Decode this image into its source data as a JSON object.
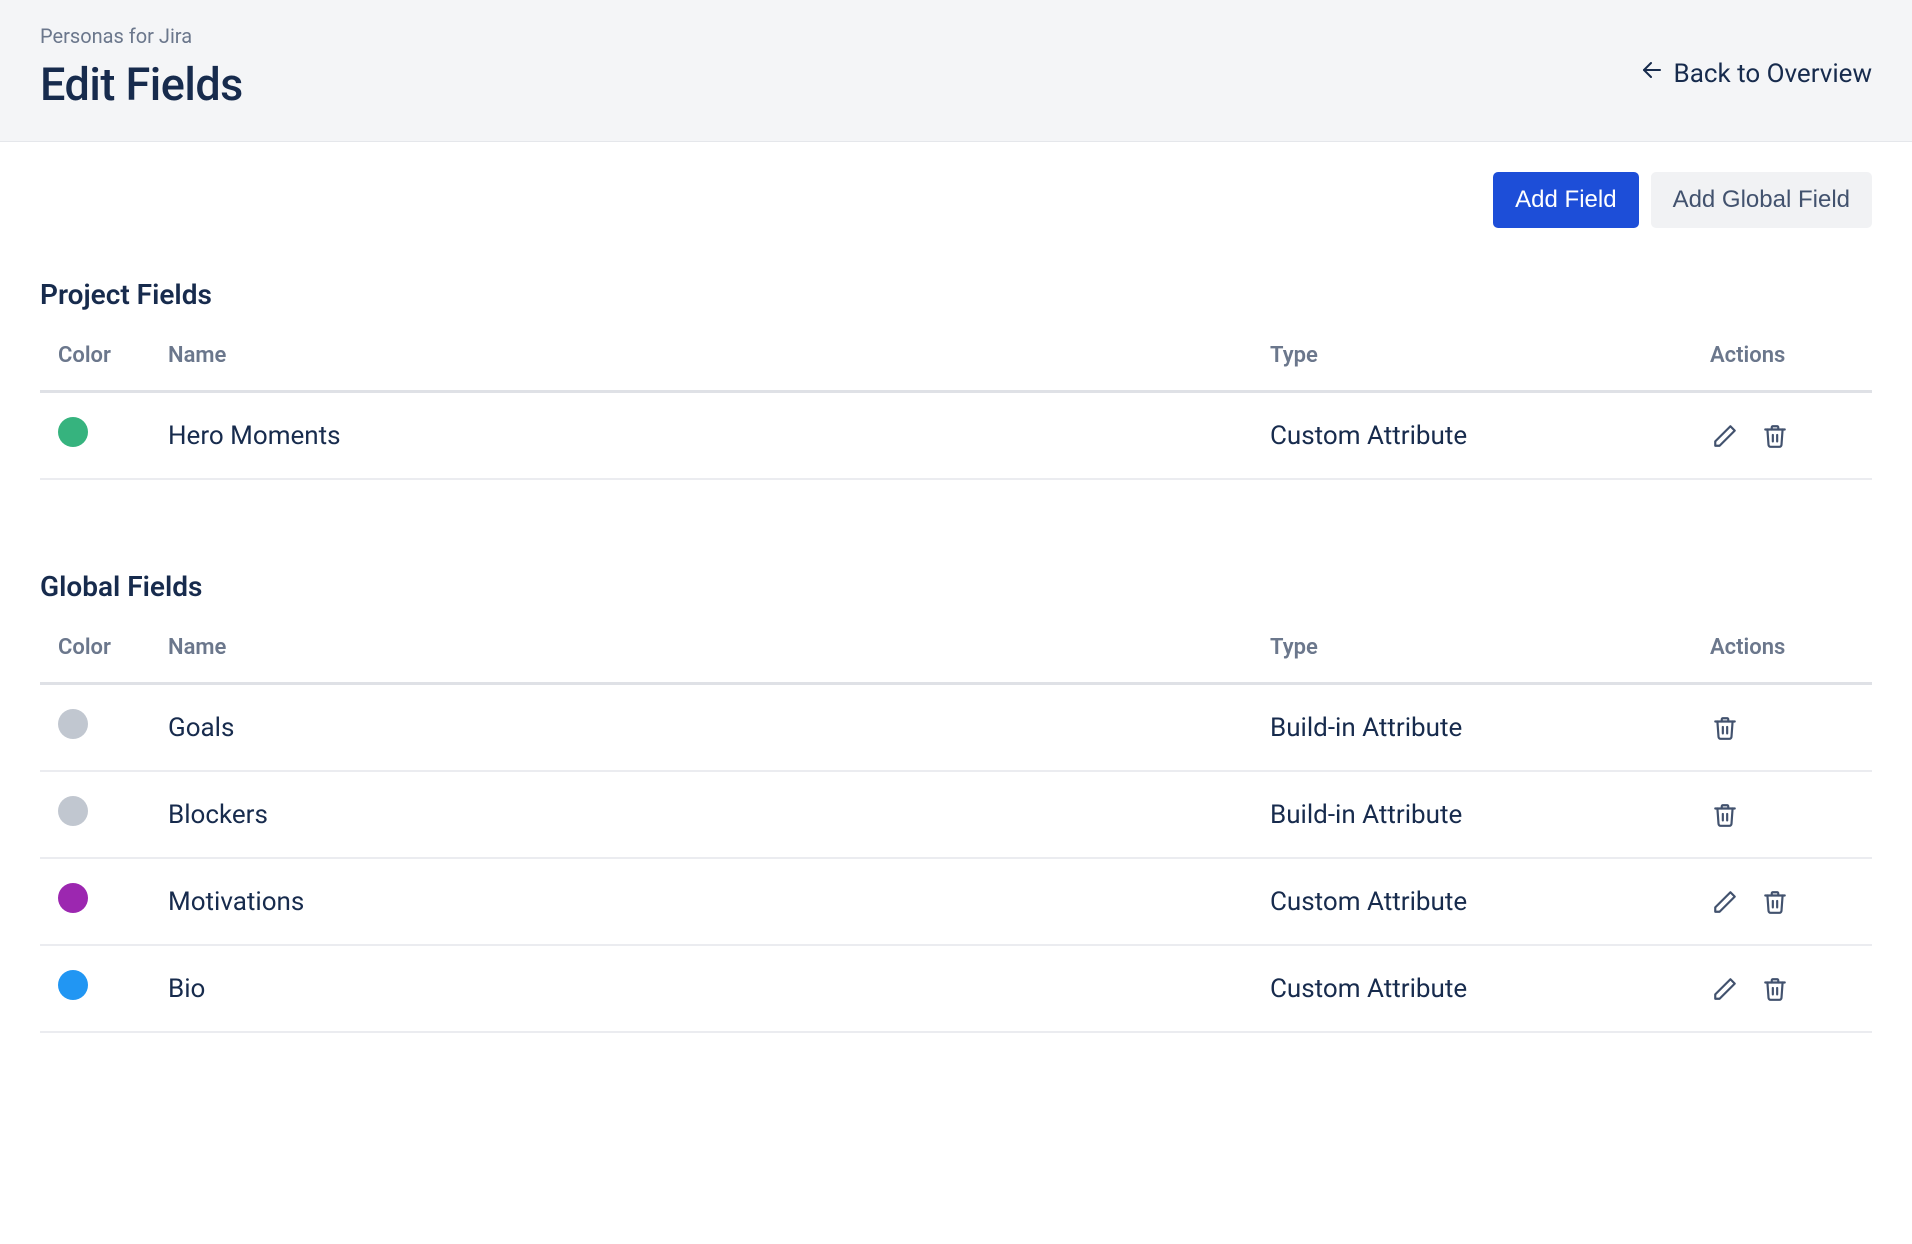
{
  "header": {
    "breadcrumb": "Personas for Jira",
    "title": "Edit Fields",
    "back_label": "Back to Overview"
  },
  "toolbar": {
    "add_field_label": "Add Field",
    "add_global_field_label": "Add Global Field"
  },
  "columns": {
    "color": "Color",
    "name": "Name",
    "type": "Type",
    "actions": "Actions"
  },
  "sections": {
    "project": {
      "title": "Project Fields",
      "rows": [
        {
          "color": "#36B37E",
          "name": "Hero Moments",
          "type": "Custom Attribute",
          "editable": true
        }
      ]
    },
    "global": {
      "title": "Global Fields",
      "rows": [
        {
          "color": "#C1C7D0",
          "name": "Goals",
          "type": "Build-in Attribute",
          "editable": false
        },
        {
          "color": "#C1C7D0",
          "name": "Blockers",
          "type": "Build-in Attribute",
          "editable": false
        },
        {
          "color": "#9C27B0",
          "name": "Motivations",
          "type": "Custom Attribute",
          "editable": true
        },
        {
          "color": "#2196F3",
          "name": "Bio",
          "type": "Custom Attribute",
          "editable": true
        }
      ]
    }
  },
  "icons": {
    "edit": "pencil-icon",
    "delete": "trash-icon",
    "back": "arrow-left-icon"
  }
}
